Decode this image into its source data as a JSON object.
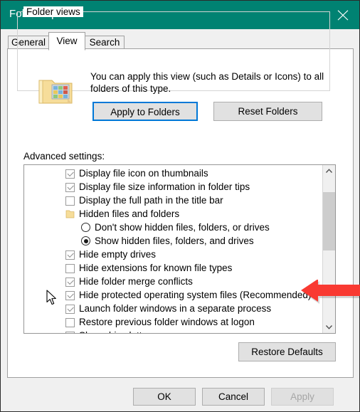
{
  "window": {
    "title": "Folder Options",
    "titlebar_color": "#008272",
    "close_icon": "close-icon"
  },
  "tabs": [
    {
      "label": "General",
      "active": false
    },
    {
      "label": "View",
      "active": true
    },
    {
      "label": "Search",
      "active": false
    }
  ],
  "folder_views": {
    "legend": "Folder views",
    "icon": "folder-views-icon",
    "description": "You can apply this view (such as Details or Icons) to all folders of this type.",
    "apply_button": "Apply to Folders",
    "reset_button": "Reset Folders",
    "focus_color": "#0078d7"
  },
  "advanced": {
    "label": "Advanced settings:",
    "items": [
      {
        "label": "Display file icon on thumbnails",
        "control": "checkbox",
        "state": "checked",
        "indent": 0
      },
      {
        "label": "Display file size information in folder tips",
        "control": "checkbox",
        "state": "checked",
        "indent": 0
      },
      {
        "label": "Display the full path in the title bar",
        "control": "checkbox",
        "state": "unchecked",
        "indent": 0
      },
      {
        "label": "Hidden files and folders",
        "control": "folder-icon",
        "state": "none",
        "indent": 0
      },
      {
        "label": "Don't show hidden files, folders, or drives",
        "control": "radio",
        "state": "unselected",
        "indent": 1
      },
      {
        "label": "Show hidden files, folders, and drives",
        "control": "radio",
        "state": "selected",
        "indent": 1
      },
      {
        "label": "Hide empty drives",
        "control": "checkbox",
        "state": "checked",
        "indent": 0
      },
      {
        "label": "Hide extensions for known file types",
        "control": "checkbox",
        "state": "unchecked",
        "indent": 0
      },
      {
        "label": "Hide folder merge conflicts",
        "control": "checkbox",
        "state": "checked",
        "indent": 0
      },
      {
        "label": "Hide protected operating system files (Recommended)",
        "control": "checkbox",
        "state": "checked",
        "indent": 0
      },
      {
        "label": "Launch folder windows in a separate process",
        "control": "checkbox",
        "state": "checked",
        "indent": 0
      },
      {
        "label": "Restore previous folder windows at logon",
        "control": "checkbox",
        "state": "unchecked",
        "indent": 0
      },
      {
        "label": "Show drive letters",
        "control": "checkbox",
        "state": "checked",
        "indent": 0
      }
    ],
    "scrollbar": {
      "up_icon": "chevron-up-icon",
      "down_icon": "chevron-down-icon",
      "thumb": "scrollbar-thumb"
    }
  },
  "restore_defaults_button": "Restore Defaults",
  "footer": {
    "ok": "OK",
    "cancel": "Cancel",
    "apply": "Apply",
    "apply_disabled": true
  },
  "annotations": {
    "arrow": {
      "name": "red-arrow-annotation",
      "color": "#f93a32",
      "points_to": "Hide protected operating system files (Recommended)"
    },
    "cursor": {
      "name": "mouse-cursor",
      "over": "Hide protected operating system files (Recommended)"
    }
  }
}
